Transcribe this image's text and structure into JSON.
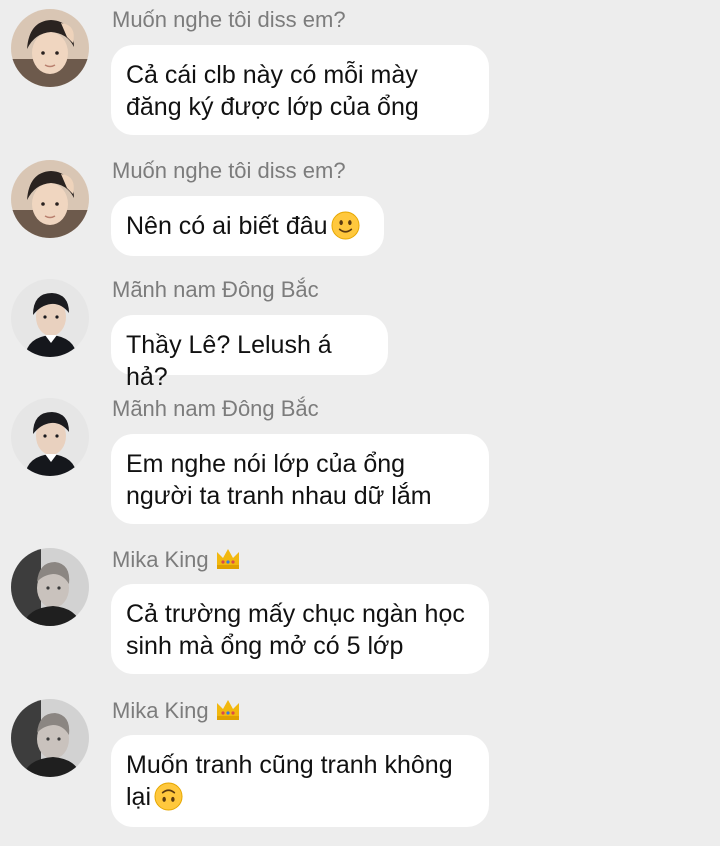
{
  "messages": [
    {
      "sender": "Muốn nghe tôi diss em?",
      "avatar": "avatar-muon-nghe",
      "lines": [
        "Cả cái clb này có mỗi mày",
        "đăng ký được lớp của ổng"
      ]
    },
    {
      "sender": "Muốn nghe tôi diss em?",
      "avatar": "avatar-muon-nghe",
      "lines": [
        "Nên có ai biết đâu"
      ],
      "emoji": "slightly-smiling-face-icon"
    },
    {
      "sender": "Mãnh nam Đông Bắc",
      "avatar": "avatar-manh-nam",
      "lines": [
        "Thầy Lê? Lelush á hả?"
      ]
    },
    {
      "sender": "Mãnh nam Đông Bắc",
      "avatar": "avatar-manh-nam",
      "lines": [
        "Em nghe nói lớp của ổng",
        "người ta tranh nhau dữ lắm"
      ]
    },
    {
      "sender": "Mika King",
      "avatar": "avatar-mika-king",
      "badge": "crown-icon",
      "lines": [
        "Cả trường mấy chục ngàn học",
        "sinh mà ổng mở có 5 lớp"
      ]
    },
    {
      "sender": "Mika King",
      "avatar": "avatar-mika-king",
      "badge": "crown-icon",
      "lines": [
        "Muốn tranh cũng tranh không",
        "lại"
      ],
      "emoji": "upside-down-face-icon"
    }
  ],
  "colors": {
    "background": "#ededed",
    "bubble": "#ffffff",
    "sender_text": "#7c7c7c",
    "message_text": "#111111",
    "crown": "#f2b80f"
  }
}
